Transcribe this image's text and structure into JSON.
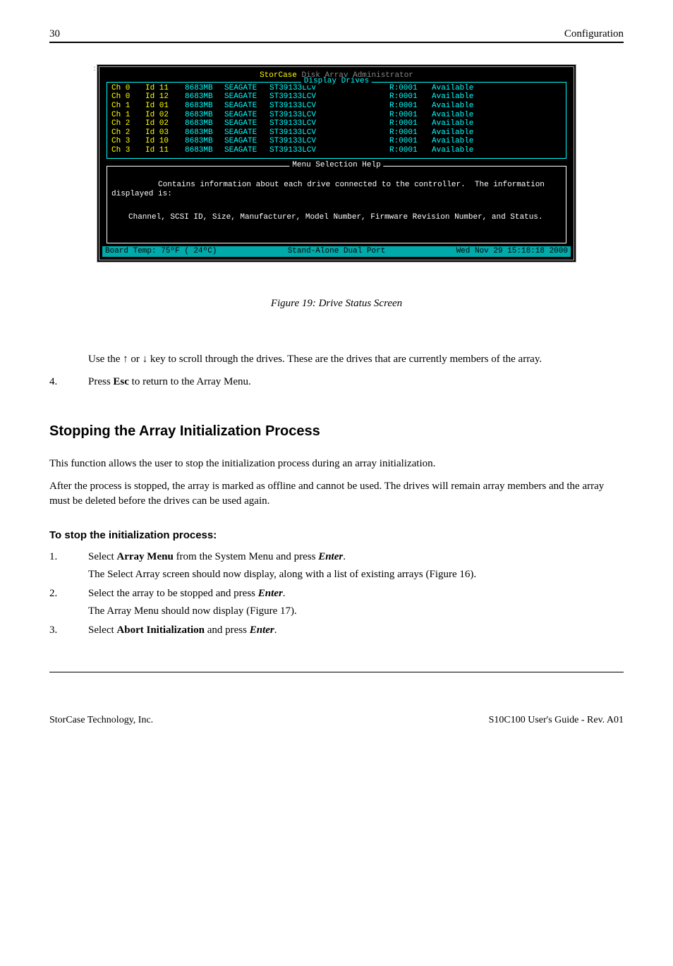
{
  "header": {
    "page_number": "30",
    "section": "Configuration"
  },
  "terminal": {
    "product": "StorCase",
    "product_suffix": "Disk Array Administrator",
    "display_title": "Display Drives",
    "drives": [
      {
        "ch": "Ch 0",
        "id": "Id 11",
        "size": "8683MB",
        "make": "SEAGATE",
        "model": "ST39133LCV",
        "rev": "R:0001",
        "status": "Available"
      },
      {
        "ch": "Ch 0",
        "id": "Id 12",
        "size": "8683MB",
        "make": "SEAGATE",
        "model": "ST39133LCV",
        "rev": "R:0001",
        "status": "Available"
      },
      {
        "ch": "Ch 1",
        "id": "Id 01",
        "size": "8683MB",
        "make": "SEAGATE",
        "model": "ST39133LCV",
        "rev": "R:0001",
        "status": "Available"
      },
      {
        "ch": "Ch 1",
        "id": "Id 02",
        "size": "8683MB",
        "make": "SEAGATE",
        "model": "ST39133LCV",
        "rev": "R:0001",
        "status": "Available"
      },
      {
        "ch": "Ch 2",
        "id": "Id 02",
        "size": "8683MB",
        "make": "SEAGATE",
        "model": "ST39133LCV",
        "rev": "R:0001",
        "status": "Available"
      },
      {
        "ch": "Ch 2",
        "id": "Id 03",
        "size": "8683MB",
        "make": "SEAGATE",
        "model": "ST39133LCV",
        "rev": "R:0001",
        "status": "Available"
      },
      {
        "ch": "Ch 3",
        "id": "Id 10",
        "size": "8683MB",
        "make": "SEAGATE",
        "model": "ST39133LCV",
        "rev": "R:0001",
        "status": "Available"
      },
      {
        "ch": "Ch 3",
        "id": "Id 11",
        "size": "8683MB",
        "make": "SEAGATE",
        "model": "ST39133LCV",
        "rev": "R:0001",
        "status": "Available"
      }
    ],
    "help_title": "Menu Selection Help",
    "help_line1": "Contains information about each drive connected to the controller.  The information displayed is:",
    "help_line2": "Channel, SCSI ID, Size, Manufacturer, Model Number, Firmware Revision Number, and Status.",
    "status_left": "Board Temp:  75ºF ( 24ºC)",
    "status_center": "Stand-Alone Dual Port",
    "status_right": "Wed Nov 29 15:18:18 2000"
  },
  "figure_caption": "Figure 19:   Drive Status Screen",
  "body": {
    "use_text_prefix": "Use the ",
    "use_text_mid": " or ",
    "use_text_suffix": " key to scroll through the drives.  These are the drives that are currently members of the array.",
    "arrow_up": "↑",
    "arrow_down": "↓",
    "step4_num": "4.",
    "step4_prefix": "Press ",
    "step4_esc": "Esc",
    "step4_suffix": " to return to the Array Menu."
  },
  "section_title": "Stopping the Array Initialization Process",
  "section_text1": "This function allows the user to stop the initialization process during an array initialization.",
  "section_text2": "After the process is stopped, the array is marked as offline and cannot be used.  The drives will remain array members and the array must be deleted before the drives can be used again.",
  "stop_heading": "To stop the initialization process:",
  "steps": [
    {
      "num": "1.",
      "prefix": "Select ",
      "bold1": "Array Menu",
      "mid": " from the System Menu and press ",
      "bolditalic": "Enter",
      "suffix": ".",
      "sub": "The Select Array screen should now display, along with a list of existing arrays (Figure 16)."
    },
    {
      "num": "2.",
      "prefix": "Select the array to be stopped and press ",
      "bold1": "",
      "mid": "",
      "bolditalic": "Enter",
      "suffix": ".",
      "sub": "The Array Menu should now display (Figure 17)."
    },
    {
      "num": "3.",
      "prefix": "Select ",
      "bold1": "Abort Initialization",
      "mid": " and press ",
      "bolditalic": "Enter",
      "suffix": ".",
      "sub": ""
    }
  ],
  "footer": {
    "left": "StorCase Technology, Inc.",
    "right": "S10C100 User's Guide - Rev. A01"
  }
}
